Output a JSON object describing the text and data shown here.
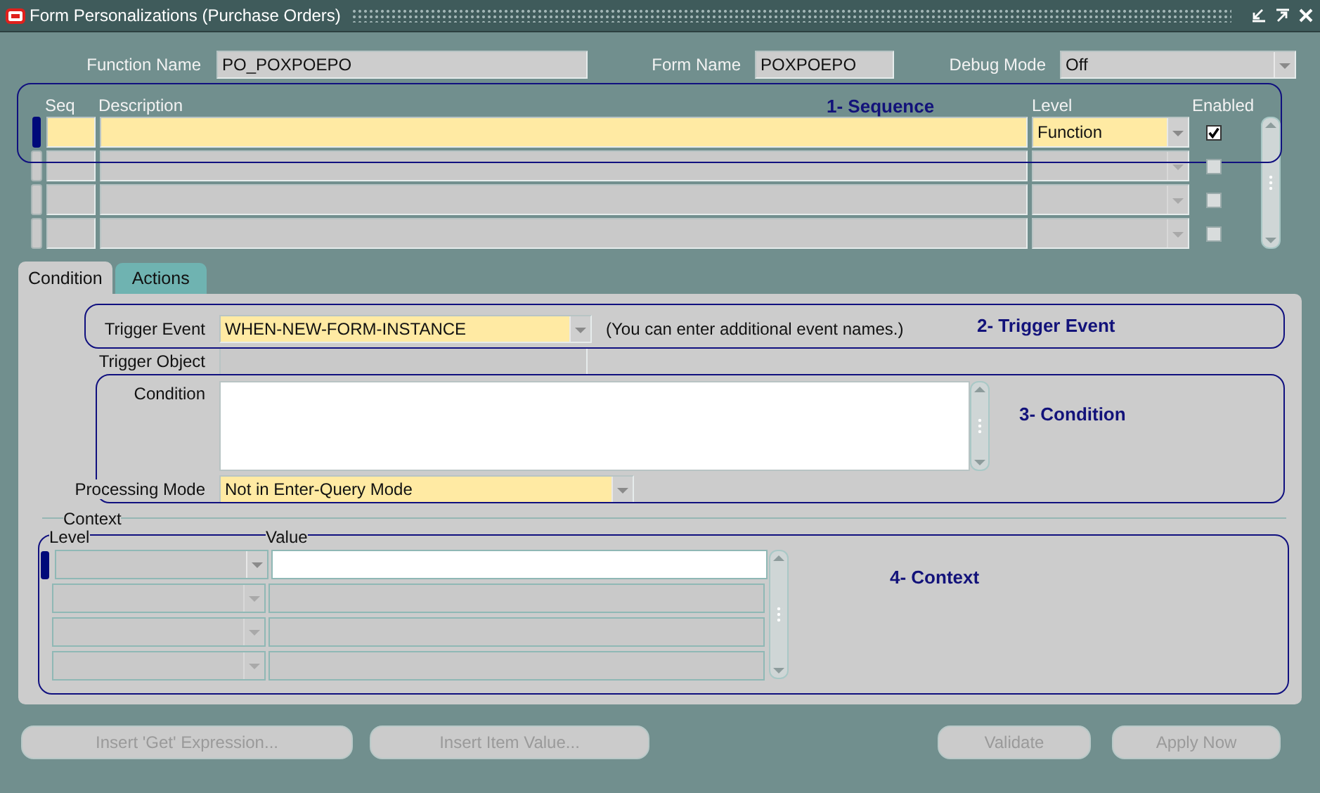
{
  "window": {
    "title": "Form Personalizations (Purchase Orders)"
  },
  "header": {
    "function_name": {
      "label": "Function Name",
      "value": "PO_POXPOEPO"
    },
    "form_name": {
      "label": "Form Name",
      "value": "POXPOEPO"
    },
    "debug_mode": {
      "label": "Debug Mode",
      "value": "Off"
    }
  },
  "rules": {
    "columns": [
      "Seq",
      "Description",
      "Level",
      "Enabled"
    ],
    "rows": [
      {
        "level": "Function",
        "enabled": true,
        "selected": true
      },
      {
        "enabled": false,
        "selected": false
      },
      {
        "enabled": false,
        "selected": false
      },
      {
        "enabled": false,
        "selected": false
      }
    ]
  },
  "tabs": [
    {
      "label": "Condition",
      "selected": true
    },
    {
      "label": "Actions",
      "selected": false
    }
  ],
  "condition": {
    "trigger_event": {
      "label": "Trigger Event",
      "value": "WHEN-NEW-FORM-INSTANCE"
    },
    "hint": "(You can enter additional event names.)",
    "trigger_object": {
      "label": "Trigger Object"
    },
    "condition": {
      "label": "Condition"
    },
    "processing_mode": {
      "label": "Processing Mode",
      "value": "Not in Enter-Query Mode"
    }
  },
  "context": {
    "title": "Context",
    "columns": [
      "Level",
      "Value"
    ],
    "rows": [
      {
        "selected": true
      },
      {
        "selected": false
      },
      {
        "selected": false
      },
      {
        "selected": false
      }
    ]
  },
  "buttons": [
    {
      "label": "Insert 'Get' Expression...",
      "disabled": true
    },
    {
      "label": "Insert Item Value...",
      "disabled": true
    },
    {
      "label": "Validate",
      "disabled": true
    },
    {
      "label": "Apply Now",
      "disabled": true
    }
  ],
  "annotations": [
    {
      "label": "1- Sequence"
    },
    {
      "label": "2- Trigger Event"
    },
    {
      "label": "3- Condition"
    },
    {
      "label": "4- Context"
    }
  ]
}
